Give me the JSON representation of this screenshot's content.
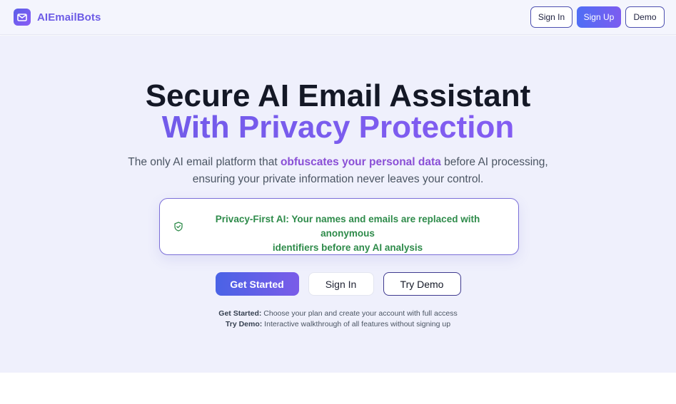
{
  "brand": {
    "name": "AIEmailBots",
    "logo_icon": "mail-icon"
  },
  "nav": {
    "sign_in": "Sign In",
    "sign_up": "Sign Up",
    "demo": "Demo"
  },
  "hero": {
    "title_line1": "Secure AI Email Assistant",
    "title_line2": "With Privacy Protection",
    "subtitle_before": "The only AI email platform that ",
    "subtitle_highlight": "obfuscates your personal data",
    "subtitle_after": " before AI processing,",
    "subtitle_line2": "ensuring your private information never leaves your control."
  },
  "privacy_card": {
    "icon": "shield-check-icon",
    "line1": "Privacy-First AI: Your names and emails are replaced with anonymous",
    "line2": "identifiers before any AI analysis"
  },
  "cta": {
    "get_started": "Get Started",
    "sign_in": "Sign In",
    "try_demo": "Try Demo"
  },
  "notes": [
    {
      "label": "Get Started:",
      "text": " Choose your plan and create your account with full access"
    },
    {
      "label": "Try Demo:",
      "text": " Interactive walkthrough of all features without signing up"
    }
  ],
  "colors": {
    "accent": "#6d5ce6",
    "primary_gradient_start": "#4a63e6",
    "primary_gradient_end": "#7a5ce8",
    "privacy_green": "#2e8b4a",
    "hero_bg": "#eff0fc"
  }
}
